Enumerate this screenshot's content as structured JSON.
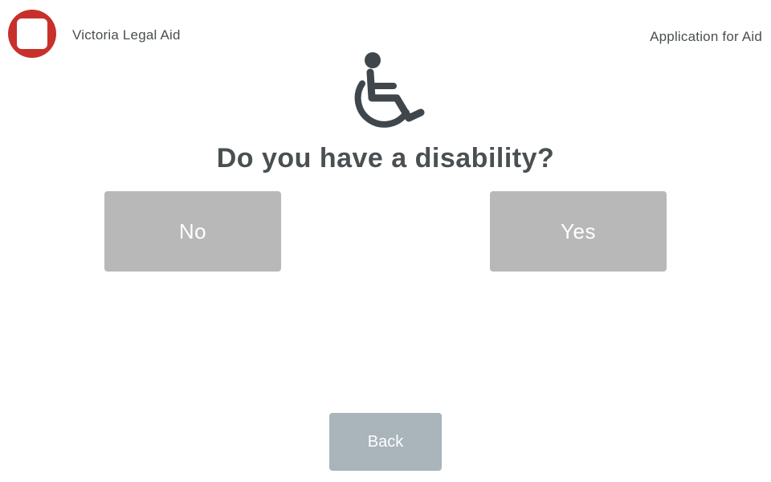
{
  "header": {
    "org_name": "Victoria Legal Aid",
    "app_title": "Application for Aid",
    "logo_icon": "vla-logo-icon"
  },
  "question": {
    "icon": "wheelchair-icon",
    "text": "Do you have a disability?"
  },
  "choices": {
    "no_label": "No",
    "yes_label": "Yes"
  },
  "navigation": {
    "back_label": "Back"
  },
  "colors": {
    "brand_red": "#c8302c",
    "text_dark": "#4a4f52",
    "choice_button": "#b8b8b8",
    "back_button": "#a9b4bb"
  }
}
